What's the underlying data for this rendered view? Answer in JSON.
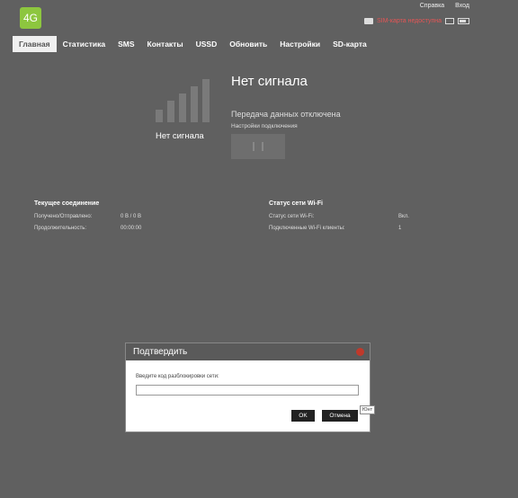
{
  "header": {
    "logo_text": "4G",
    "help_link": "Справка",
    "login_link": "Вход",
    "sim_status": "SIM-карта недоступна"
  },
  "nav": [
    "Главная",
    "Статистика",
    "SMS",
    "Контакты",
    "USSD",
    "Обновить",
    "Настройки",
    "SD-карта"
  ],
  "signal": {
    "caption": "Нет сигнала",
    "title": "Нет сигнала",
    "data_status": "Передача данных отключена",
    "conn_settings": "Настройки подключения"
  },
  "current_connection": {
    "title": "Текущее соединение",
    "rows": [
      {
        "label": "Получено/Отправлено:",
        "value": "0 B / 0 B"
      },
      {
        "label": "Продолжительность:",
        "value": "00:00:00"
      }
    ]
  },
  "wifi_status": {
    "title": "Статус сети Wi-Fi",
    "rows": [
      {
        "label": "Статус сети Wi-Fi:",
        "value": "Вкл."
      },
      {
        "label": "Подключенные Wi-Fi клиенты:",
        "value": "1"
      }
    ]
  },
  "dialog": {
    "title": "Подтвердить",
    "label": "Введите код разблокировки сети:",
    "input_value": "",
    "ok_label": "OK",
    "cancel_label": "Отмена",
    "tooltip": "Юнт"
  },
  "colors": {
    "background": "#606060",
    "logo": "#8dc63f",
    "sim_warning": "#e45555",
    "close": "#c0392b"
  }
}
